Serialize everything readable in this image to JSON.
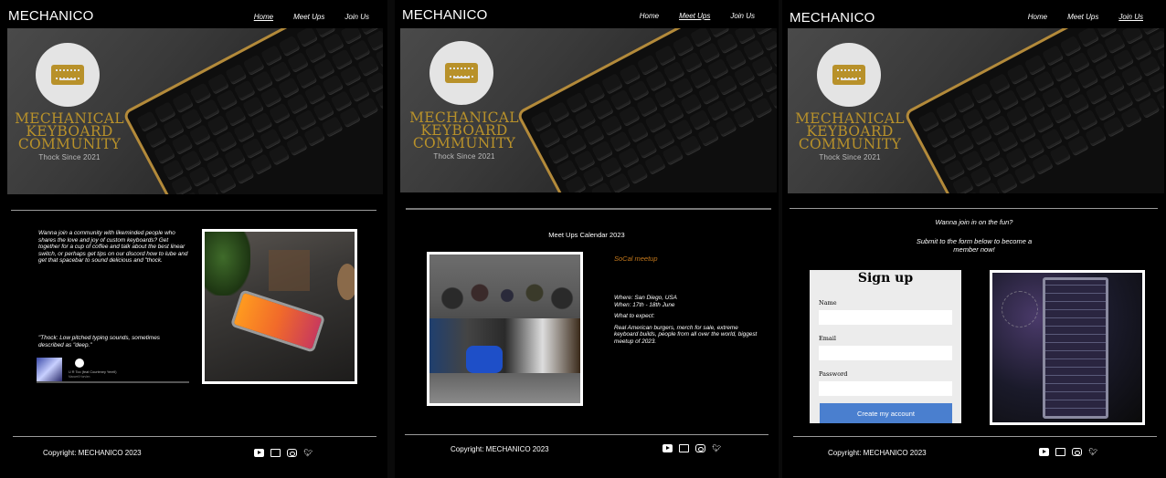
{
  "brand": "MECHANICO",
  "nav": {
    "home": "Home",
    "meetups": "Meet Ups",
    "join": "Join Us"
  },
  "hero": {
    "line1": "MECHANICAL",
    "line2": "KEYBOARD",
    "line3": "COMMUNITY",
    "tagline": "Thock Since 2021"
  },
  "home": {
    "intro": "Wanna join a community with likeminded people who shares the love and joy of custom keyboards? Get together for a cup of coffee and talk about the best linear switch, or perhaps get tips on our discord how to lube and get that spacebar to sound delicious and \"thock.",
    "definition": "\"Thock: Low pitched typing sounds, sometimes described as \"deep.\"",
    "player_track": "U R Too (feat Courteney Yerell)",
    "player_artist": "Maxwell Horvlen"
  },
  "meetups": {
    "heading": "Meet Ups Calendar 2023",
    "event": "SoCal meetup",
    "where": "Where: San Diego, USA",
    "when": "When: 17th - 18th June",
    "expect_label": "What to expect:",
    "expect_text": "Real American burgers, merch for sale, extreme keyboard builds, people from all over the world, biggest meetup of 2023."
  },
  "join": {
    "heading": "Wanna join in on the fun?",
    "subheading": "Submit to the form below to become a member now!",
    "form_title": "Sign up",
    "name_label": "Name",
    "email_label": "Email",
    "password_label": "Password",
    "submit": "Create my account"
  },
  "footer": {
    "copyright": "Copyright: MECHANICO 2023"
  },
  "icons": [
    "youtube-icon",
    "twitch-icon",
    "instagram-icon",
    "twitter-icon"
  ],
  "colors": {
    "background": "#000000",
    "gold": "#b8912a",
    "button": "#4a7fcf",
    "event": "#c77a1c"
  }
}
